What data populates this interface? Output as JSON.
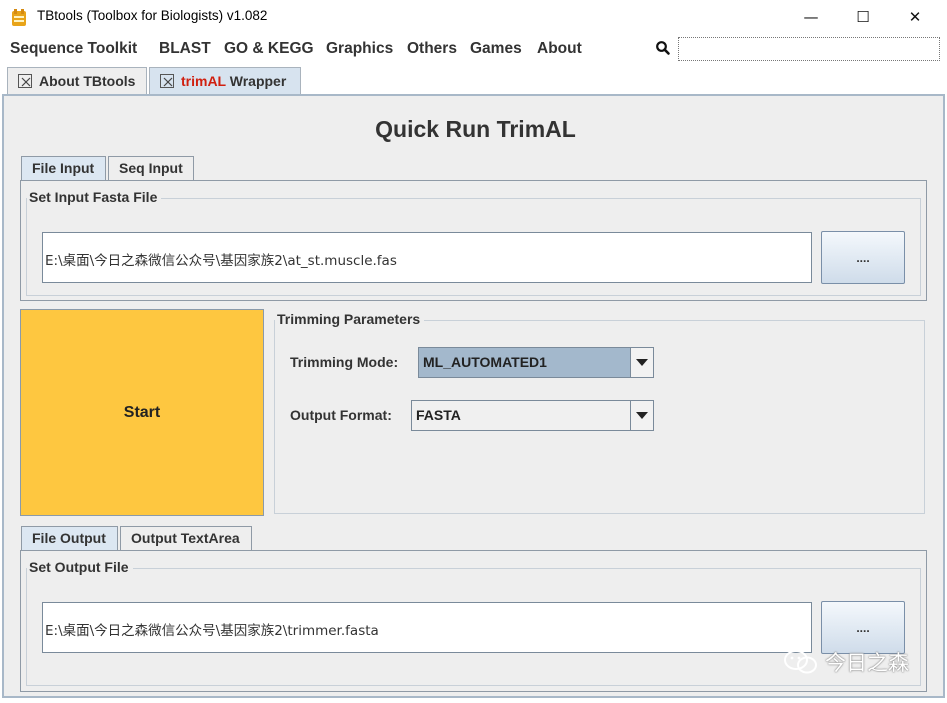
{
  "window": {
    "title": "TBtools (Toolbox for Biologists) v1.082",
    "minimize": "—",
    "maximize": "☐",
    "close": "✕"
  },
  "menu": {
    "items": [
      "Sequence Toolkit",
      "BLAST",
      "GO & KEGG",
      "Graphics",
      "Others",
      "Games",
      "About"
    ],
    "search_placeholder": ""
  },
  "doc_tabs": [
    {
      "label": "About TBtools",
      "active": false
    },
    {
      "label_red": "trimAL",
      "label": " Wrapper",
      "active": true
    }
  ],
  "main": {
    "heading": "Quick Run TrimAL",
    "input_tabs": [
      "File Input",
      "Seq Input"
    ],
    "input_group_title": "Set Input Fasta File",
    "input_path": "E:\\桌面\\今日之森微信公众号\\基因家族2\\at_st.muscle.fas",
    "browse_label": "....",
    "start_label": "Start",
    "params_title": "Trimming Parameters",
    "trimming_mode_label": "Trimming Mode:",
    "trimming_mode_value": "ML_AUTOMATED1",
    "output_format_label": "Output Format:",
    "output_format_value": "FASTA",
    "output_tabs": [
      "File Output",
      "Output TextArea"
    ],
    "output_group_title": "Set Output File",
    "output_path": "E:\\桌面\\今日之森微信公众号\\基因家族2\\trimmer.fasta"
  },
  "watermark": {
    "text": "今日之森",
    "icon": "wechat-icon"
  },
  "colors": {
    "start_button": "#fec740",
    "tab_active": "#d7e3ef",
    "combo_highlight": "#a3b8cc",
    "red_text": "#d02010"
  }
}
